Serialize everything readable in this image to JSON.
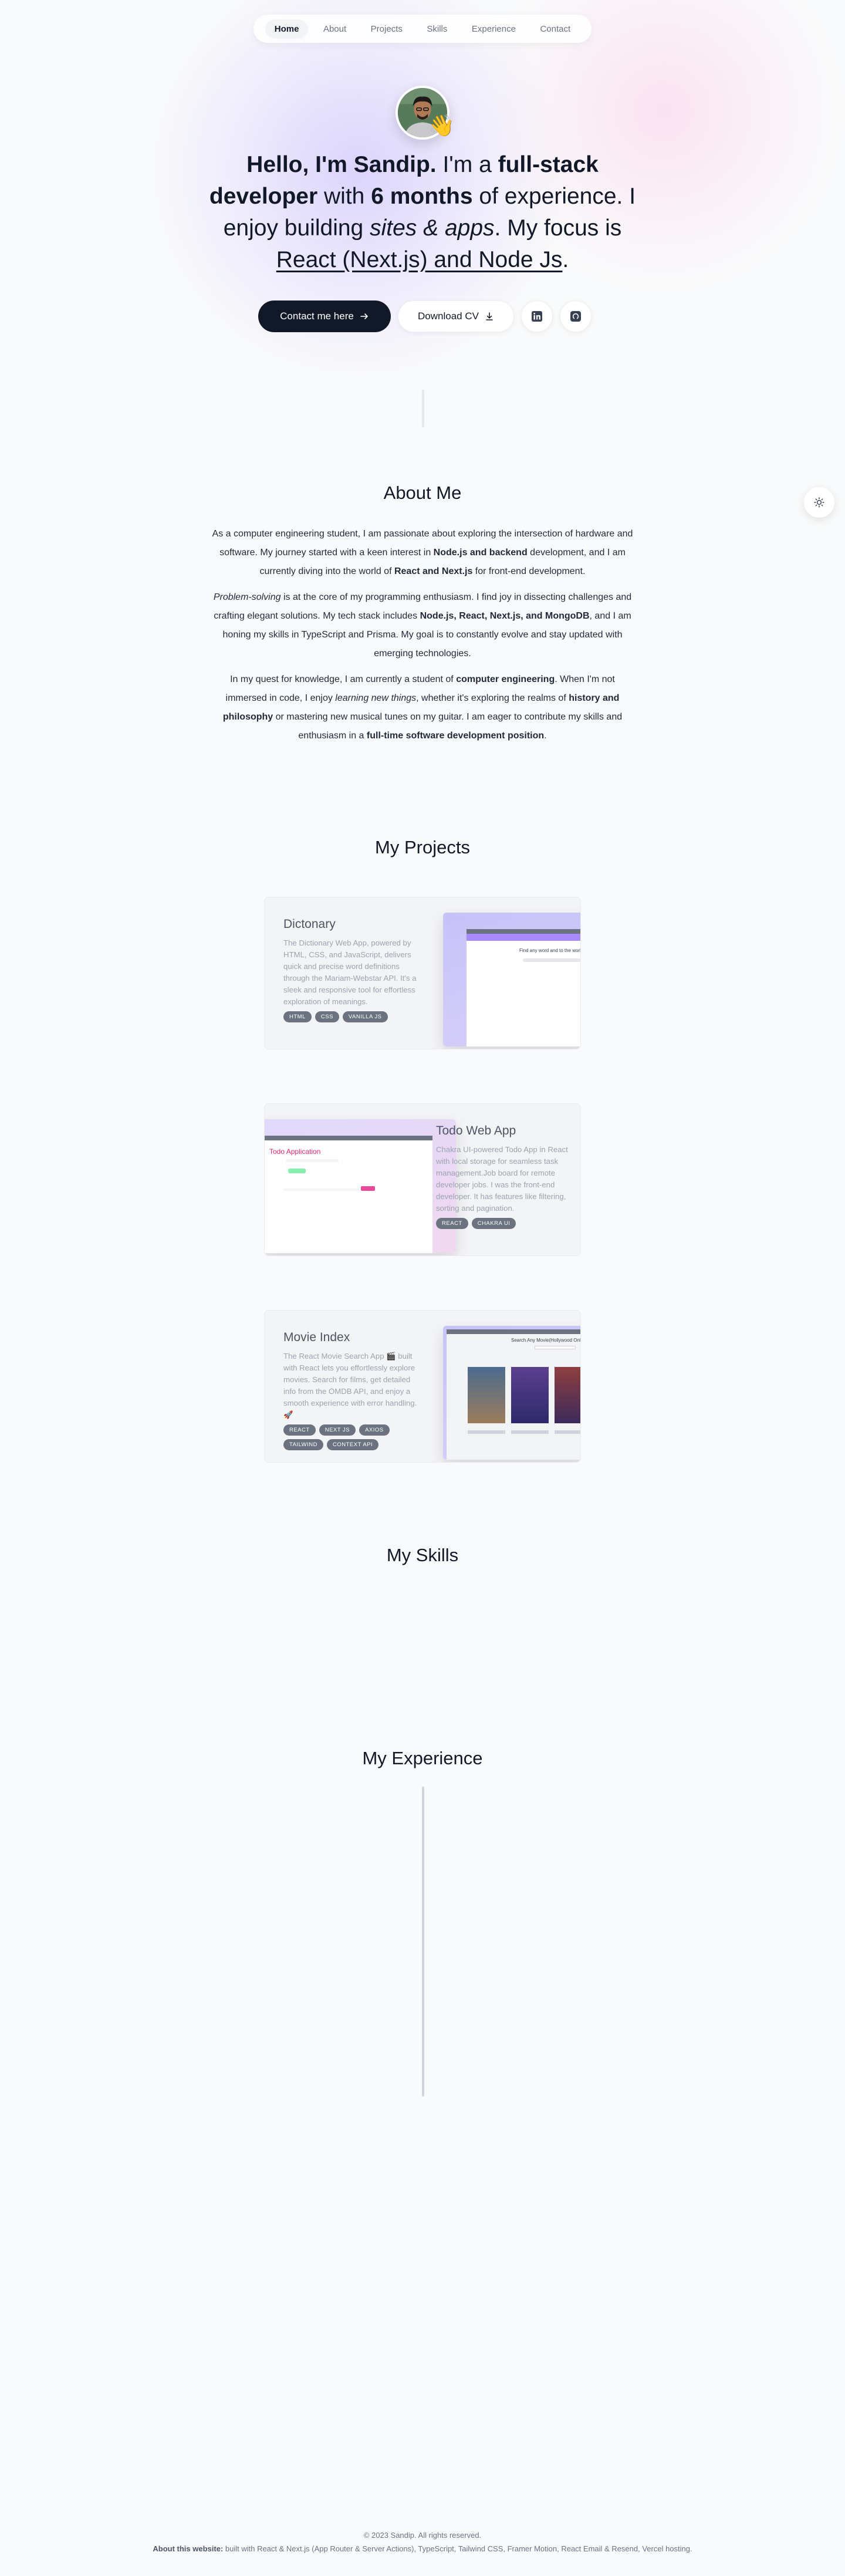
{
  "nav": {
    "items": [
      {
        "label": "Home",
        "active": true
      },
      {
        "label": "About"
      },
      {
        "label": "Projects"
      },
      {
        "label": "Skills"
      },
      {
        "label": "Experience"
      },
      {
        "label": "Contact"
      }
    ]
  },
  "hero": {
    "avatar_icon": "profile-photo",
    "wave_emoji": "👋",
    "text": {
      "t1": "Hello, I'm Sandip.",
      "t2": " I'm a ",
      "t3": "full-stack developer",
      "t4": " with ",
      "t5": "6 months",
      "t6": " of experience. I enjoy building ",
      "t7": "sites & apps",
      "t8": ". My focus is ",
      "t9": "React (Next.js) and Node Js",
      "t10": "."
    },
    "contact_label": "Contact me here",
    "download_label": "Download CV",
    "contact_icon": "arrow-right-icon",
    "download_icon": "download-icon",
    "linkedin_icon": "linkedin-icon",
    "github_icon": "github-icon"
  },
  "theme_toggle": {
    "icon": "sun-icon"
  },
  "about": {
    "heading": "About Me",
    "p1": {
      "a": "As a computer engineering student, I am passionate about exploring the intersection of hardware and software. My journey started with a keen interest in ",
      "b": "Node.js and backend",
      "c": " development, and I am currently diving into the world of ",
      "d": "React and Next.js",
      "e": " for front-end development."
    },
    "p2": {
      "a": "Problem-solving",
      "b": " is at the core of my programming enthusiasm. I find joy in dissecting challenges and crafting elegant solutions. My tech stack includes ",
      "c": "Node.js, React, Next.js, and MongoDB",
      "d": ", and I am honing my skills in TypeScript and Prisma. My goal is to constantly evolve and stay updated with emerging technologies."
    },
    "p3": {
      "a": "In my quest for knowledge, I am currently a student of ",
      "b": "computer engineering",
      "c": ". When I'm not immersed in code, I enjoy ",
      "d": "learning new things",
      "e": ", whether it's exploring the realms of ",
      "f": "history and philosophy",
      "g": " or mastering new musical tunes on my guitar. I am eager to contribute my skills and enthusiasm in a ",
      "h": "full-time software development position",
      "i": "."
    }
  },
  "projects": {
    "heading": "My Projects",
    "items": [
      {
        "title": "Dictonary",
        "description": "The Dictionary Web App, powered by HTML, CSS, and JavaScript, delivers quick and precise word definitions through the Mariam-Webstar API. It's a sleek and responsive tool for effortless exploration of meanings.",
        "tags": [
          "HTML",
          "CSS",
          "VANILLA JS"
        ],
        "screenshot": {
          "text": "Find any word and to the world"
        }
      },
      {
        "title": "Todo Web App",
        "description": "Chakra UI-powered Todo App in React with local storage for seamless task management.Job board for remote developer jobs. I was the front-end developer. It has features like filtering, sorting and pagination.",
        "tags": [
          "REACT",
          "CHAKRA UI"
        ],
        "screenshot": {
          "text": "Todo Application"
        }
      },
      {
        "title": "Movie Index",
        "description": "The React Movie Search App 🎬 built with React lets you effortlessly explore movies. Search for films, get detailed info from the OMDB API, and enjoy a smooth experience with error handling. 🚀",
        "tags": [
          "REACT",
          "NEXT JS",
          "AXIOS",
          "TAILWIND",
          "CONTEXT API"
        ],
        "screenshot": {
          "text": "Search Any Movie(Hollywood Only)"
        }
      }
    ]
  },
  "skills": {
    "heading": "My Skills"
  },
  "experience": {
    "heading": "My Experience"
  },
  "footer": {
    "copyright": "© 2023 Sandip. All rights reserved.",
    "about_label": "About this website:",
    "about_text": " built with React & Next.js (App Router & Server Actions), TypeScript, Tailwind CSS, Framer Motion, React Email & Resend, Vercel hosting."
  },
  "colors": {
    "background": "#f9fafb",
    "primary_button": "#111827",
    "tag": "#6b7280",
    "accent_purple": "#c4b5fd",
    "accent_pink": "#fbcfe8"
  }
}
